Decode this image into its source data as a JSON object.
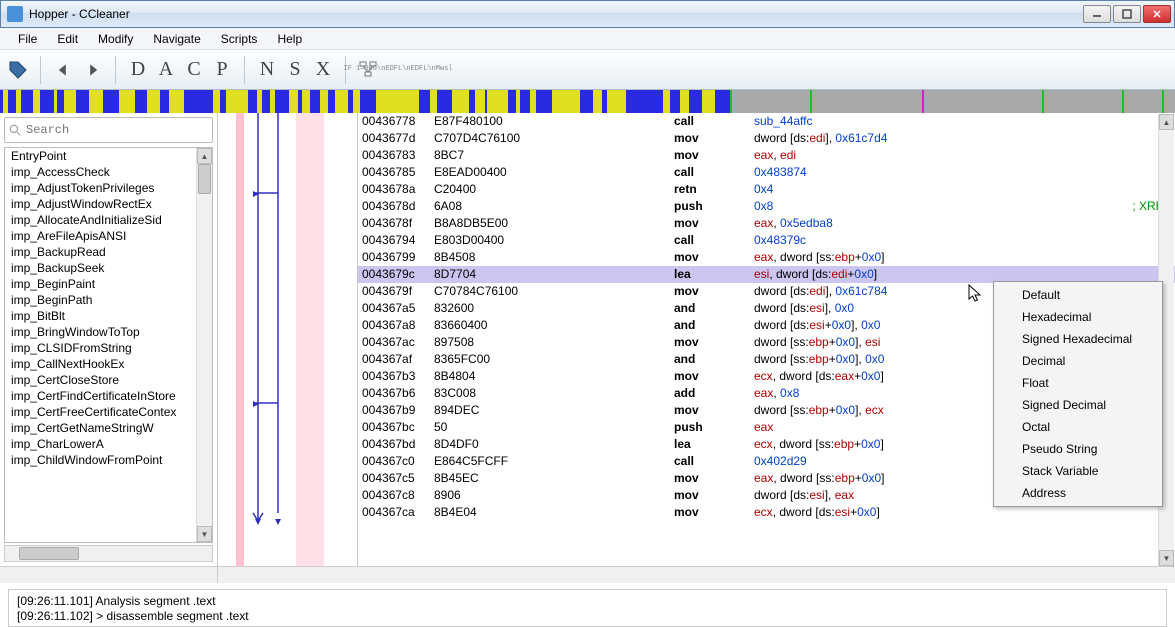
{
  "window": {
    "title": "Hopper - CCleaner"
  },
  "menu": [
    "File",
    "Edit",
    "Modify",
    "Navigate",
    "Scripts",
    "Help"
  ],
  "toolbar_letters": [
    "D",
    "A",
    "C",
    "P",
    "N",
    "S",
    "X"
  ],
  "search": {
    "placeholder": "Search"
  },
  "symbols": [
    "EntryPoint",
    "imp_AccessCheck",
    "imp_AdjustTokenPrivileges",
    "imp_AdjustWindowRectEx",
    "imp_AllocateAndInitializeSid",
    "imp_AreFileApisANSI",
    "imp_BackupRead",
    "imp_BackupSeek",
    "imp_BeginPaint",
    "imp_BeginPath",
    "imp_BitBlt",
    "imp_BringWindowToTop",
    "imp_CLSIDFromString",
    "imp_CallNextHookEx",
    "imp_CertCloseStore",
    "imp_CertFindCertificateInStore",
    "imp_CertFreeCertificateContex",
    "imp_CertGetNameStringW",
    "imp_CharLowerA",
    "imp_ChildWindowFromPoint"
  ],
  "code": [
    {
      "addr": "00436778",
      "bytes": "E87F480100",
      "mnem": "call",
      "ops": [
        {
          "t": "sym",
          "v": "sub_44affc"
        }
      ]
    },
    {
      "addr": "0043677d",
      "bytes": "C707D4C76100",
      "mnem": "mov",
      "ops": [
        {
          "t": "txt",
          "v": "dword [ds:"
        },
        {
          "t": "reg",
          "v": "edi"
        },
        {
          "t": "txt",
          "v": "], "
        },
        {
          "t": "num",
          "v": "0x61c7d4"
        }
      ]
    },
    {
      "addr": "00436783",
      "bytes": "8BC7",
      "mnem": "mov",
      "ops": [
        {
          "t": "reg",
          "v": "eax"
        },
        {
          "t": "txt",
          "v": ", "
        },
        {
          "t": "reg",
          "v": "edi"
        }
      ]
    },
    {
      "addr": "00436785",
      "bytes": "E8EAD00400",
      "mnem": "call",
      "ops": [
        {
          "t": "num",
          "v": "0x483874"
        }
      ]
    },
    {
      "addr": "0043678a",
      "bytes": "C20400",
      "mnem": "retn",
      "ops": [
        {
          "t": "num",
          "v": "0x4"
        }
      ]
    },
    {
      "addr": "0043678d",
      "bytes": "6A08",
      "mnem": "push",
      "ops": [
        {
          "t": "num",
          "v": "0x8"
        }
      ],
      "xref": "; XREF"
    },
    {
      "addr": "0043678f",
      "bytes": "B8A8DB5E00",
      "mnem": "mov",
      "ops": [
        {
          "t": "reg",
          "v": "eax"
        },
        {
          "t": "txt",
          "v": ", "
        },
        {
          "t": "num",
          "v": "0x5edba8"
        }
      ]
    },
    {
      "addr": "00436794",
      "bytes": "E803D00400",
      "mnem": "call",
      "ops": [
        {
          "t": "num",
          "v": "0x48379c"
        }
      ]
    },
    {
      "addr": "00436799",
      "bytes": "8B4508",
      "mnem": "mov",
      "ops": [
        {
          "t": "reg",
          "v": "eax"
        },
        {
          "t": "txt",
          "v": ", dword [ss:"
        },
        {
          "t": "reg",
          "v": "ebp"
        },
        {
          "t": "txt",
          "v": "+"
        },
        {
          "t": "num",
          "v": "0x0"
        },
        {
          "t": "txt",
          "v": "]"
        }
      ]
    },
    {
      "addr": "0043679c",
      "bytes": "8D7704",
      "mnem": "lea",
      "sel": true,
      "ops": [
        {
          "t": "reg",
          "v": "esi"
        },
        {
          "t": "txt",
          "v": ", dword [ds:"
        },
        {
          "t": "reg",
          "v": "edi"
        },
        {
          "t": "txt",
          "v": "+"
        },
        {
          "t": "num",
          "v": "0x0"
        },
        {
          "t": "txt",
          "v": "]"
        }
      ]
    },
    {
      "addr": "0043679f",
      "bytes": "C70784C76100",
      "mnem": "mov",
      "ops": [
        {
          "t": "txt",
          "v": "dword [ds:"
        },
        {
          "t": "reg",
          "v": "edi"
        },
        {
          "t": "txt",
          "v": "], "
        },
        {
          "t": "num",
          "v": "0x61c784"
        }
      ]
    },
    {
      "addr": "004367a5",
      "bytes": "832600",
      "mnem": "and",
      "ops": [
        {
          "t": "txt",
          "v": "dword [ds:"
        },
        {
          "t": "reg",
          "v": "esi"
        },
        {
          "t": "txt",
          "v": "], "
        },
        {
          "t": "num",
          "v": "0x0"
        }
      ]
    },
    {
      "addr": "004367a8",
      "bytes": "83660400",
      "mnem": "and",
      "ops": [
        {
          "t": "txt",
          "v": "dword [ds:"
        },
        {
          "t": "reg",
          "v": "esi"
        },
        {
          "t": "txt",
          "v": "+"
        },
        {
          "t": "num",
          "v": "0x0"
        },
        {
          "t": "txt",
          "v": "], "
        },
        {
          "t": "num",
          "v": "0x0"
        }
      ]
    },
    {
      "addr": "004367ac",
      "bytes": "897508",
      "mnem": "mov",
      "ops": [
        {
          "t": "txt",
          "v": "dword [ss:"
        },
        {
          "t": "reg",
          "v": "ebp"
        },
        {
          "t": "txt",
          "v": "+"
        },
        {
          "t": "num",
          "v": "0x0"
        },
        {
          "t": "txt",
          "v": "], "
        },
        {
          "t": "reg",
          "v": "esi"
        }
      ]
    },
    {
      "addr": "004367af",
      "bytes": "8365FC00",
      "mnem": "and",
      "ops": [
        {
          "t": "txt",
          "v": "dword [ss:"
        },
        {
          "t": "reg",
          "v": "ebp"
        },
        {
          "t": "txt",
          "v": "+"
        },
        {
          "t": "num",
          "v": "0x0"
        },
        {
          "t": "txt",
          "v": "], "
        },
        {
          "t": "num",
          "v": "0x0"
        }
      ]
    },
    {
      "addr": "004367b3",
      "bytes": "8B4804",
      "mnem": "mov",
      "ops": [
        {
          "t": "reg",
          "v": "ecx"
        },
        {
          "t": "txt",
          "v": ", dword [ds:"
        },
        {
          "t": "reg",
          "v": "eax"
        },
        {
          "t": "txt",
          "v": "+"
        },
        {
          "t": "num",
          "v": "0x0"
        },
        {
          "t": "txt",
          "v": "]"
        }
      ]
    },
    {
      "addr": "004367b6",
      "bytes": "83C008",
      "mnem": "add",
      "ops": [
        {
          "t": "reg",
          "v": "eax"
        },
        {
          "t": "txt",
          "v": ", "
        },
        {
          "t": "num",
          "v": "0x8"
        }
      ]
    },
    {
      "addr": "004367b9",
      "bytes": "894DEC",
      "mnem": "mov",
      "ops": [
        {
          "t": "txt",
          "v": "dword [ss:"
        },
        {
          "t": "reg",
          "v": "ebp"
        },
        {
          "t": "txt",
          "v": "+"
        },
        {
          "t": "num",
          "v": "0x0"
        },
        {
          "t": "txt",
          "v": "], "
        },
        {
          "t": "reg",
          "v": "ecx"
        }
      ]
    },
    {
      "addr": "004367bc",
      "bytes": "50",
      "mnem": "push",
      "ops": [
        {
          "t": "reg",
          "v": "eax"
        }
      ]
    },
    {
      "addr": "004367bd",
      "bytes": "8D4DF0",
      "mnem": "lea",
      "ops": [
        {
          "t": "reg",
          "v": "ecx"
        },
        {
          "t": "txt",
          "v": ", dword [ss:"
        },
        {
          "t": "reg",
          "v": "ebp"
        },
        {
          "t": "txt",
          "v": "+"
        },
        {
          "t": "num",
          "v": "0x0"
        },
        {
          "t": "txt",
          "v": "]"
        }
      ]
    },
    {
      "addr": "004367c0",
      "bytes": "E864C5FCFF",
      "mnem": "call",
      "ops": [
        {
          "t": "num",
          "v": "0x402d29"
        }
      ]
    },
    {
      "addr": "004367c5",
      "bytes": "8B45EC",
      "mnem": "mov",
      "ops": [
        {
          "t": "reg",
          "v": "eax"
        },
        {
          "t": "txt",
          "v": ", dword [ss:"
        },
        {
          "t": "reg",
          "v": "ebp"
        },
        {
          "t": "txt",
          "v": "+"
        },
        {
          "t": "num",
          "v": "0x0"
        },
        {
          "t": "txt",
          "v": "]"
        }
      ]
    },
    {
      "addr": "004367c8",
      "bytes": "8906",
      "mnem": "mov",
      "ops": [
        {
          "t": "txt",
          "v": "dword [ds:"
        },
        {
          "t": "reg",
          "v": "esi"
        },
        {
          "t": "txt",
          "v": "], "
        },
        {
          "t": "reg",
          "v": "eax"
        }
      ]
    },
    {
      "addr": "004367ca",
      "bytes": "8B4E04",
      "mnem": "mov",
      "ops": [
        {
          "t": "reg",
          "v": "ecx"
        },
        {
          "t": "txt",
          "v": ", dword [ds:"
        },
        {
          "t": "reg",
          "v": "esi"
        },
        {
          "t": "txt",
          "v": "+"
        },
        {
          "t": "num",
          "v": "0x0"
        },
        {
          "t": "txt",
          "v": "]"
        }
      ]
    }
  ],
  "context_menu": [
    "Default",
    "Hexadecimal",
    "Signed Hexadecimal",
    "Decimal",
    "Float",
    "Signed Decimal",
    "Octal",
    "Pseudo String",
    "Stack Variable",
    "Address"
  ],
  "console": [
    "[09:26:11.101] Analysis segment .text",
    "[09:26:11.102] > disassemble segment .text"
  ]
}
